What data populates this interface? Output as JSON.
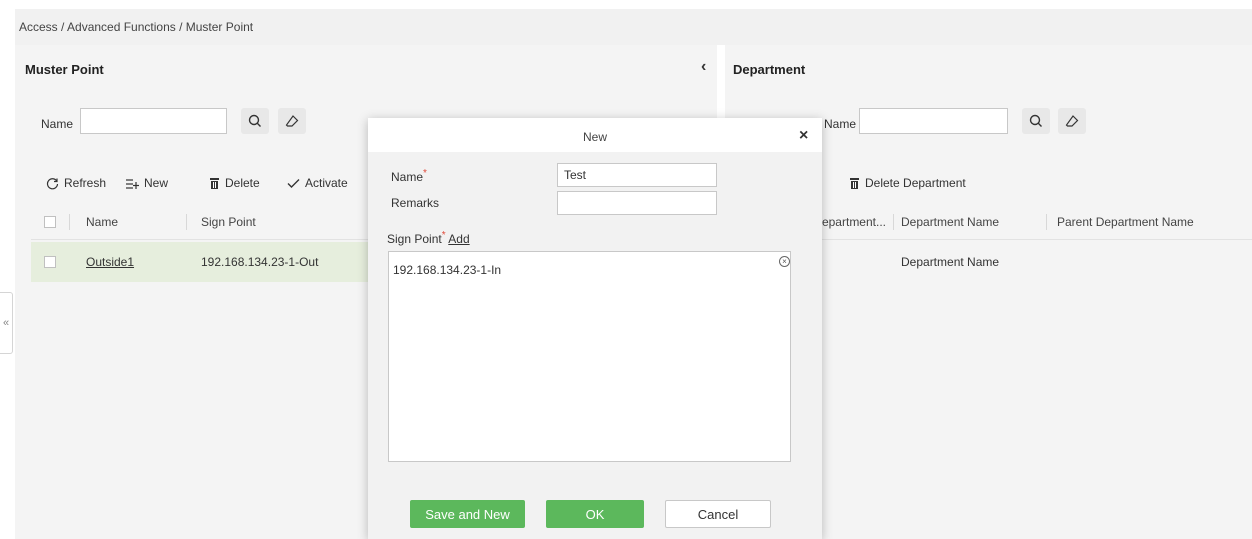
{
  "breadcrumb": "Access / Advanced Functions / Muster Point",
  "colors": {
    "accent_green": "#5cb85c",
    "required": "#e04a3a",
    "selected_row": "#e6eedd"
  },
  "left_panel": {
    "title": "Muster Point",
    "collapse_icon": "chevron-left-icon",
    "search": {
      "label": "Name",
      "value": "",
      "search_icon": "search-icon",
      "clear_icon": "eraser-icon"
    },
    "toolbar": [
      {
        "label": "Refresh",
        "icon": "refresh-icon"
      },
      {
        "label": "New",
        "icon": "new-list-icon"
      },
      {
        "label": "Delete",
        "icon": "trash-icon"
      },
      {
        "label": "Activate",
        "icon": "check-icon"
      }
    ],
    "table": {
      "columns": [
        "Name",
        "Sign Point"
      ],
      "rows": [
        {
          "name": "Outside1",
          "sign_point": "192.168.134.23-1-Out",
          "selected": true
        }
      ]
    }
  },
  "right_panel": {
    "title": "Department",
    "search": {
      "label_partial": "Department Name",
      "value": "",
      "search_icon": "search-icon",
      "clear_icon": "eraser-icon"
    },
    "toolbar": [
      {
        "label": "Delete Department",
        "icon": "trash-icon"
      }
    ],
    "table": {
      "columns": [
        "Department...",
        "Department Name",
        "Parent Department Name"
      ],
      "rows": [
        {
          "department_name": "Department Name"
        }
      ]
    }
  },
  "side_tab": {
    "label": "«"
  },
  "modal": {
    "title": "New",
    "close_label": "×",
    "name_label": "Name",
    "name_value": "Test",
    "remarks_label": "Remarks",
    "remarks_value": "",
    "sign_point_label": "Sign Point",
    "required_mark": "*",
    "add_label": "Add",
    "sign_points": [
      {
        "value": "192.168.134.23-1-In",
        "remove_icon": "remove-circle-icon"
      }
    ],
    "buttons": {
      "save_new": "Save and New",
      "ok": "OK",
      "cancel": "Cancel"
    }
  }
}
